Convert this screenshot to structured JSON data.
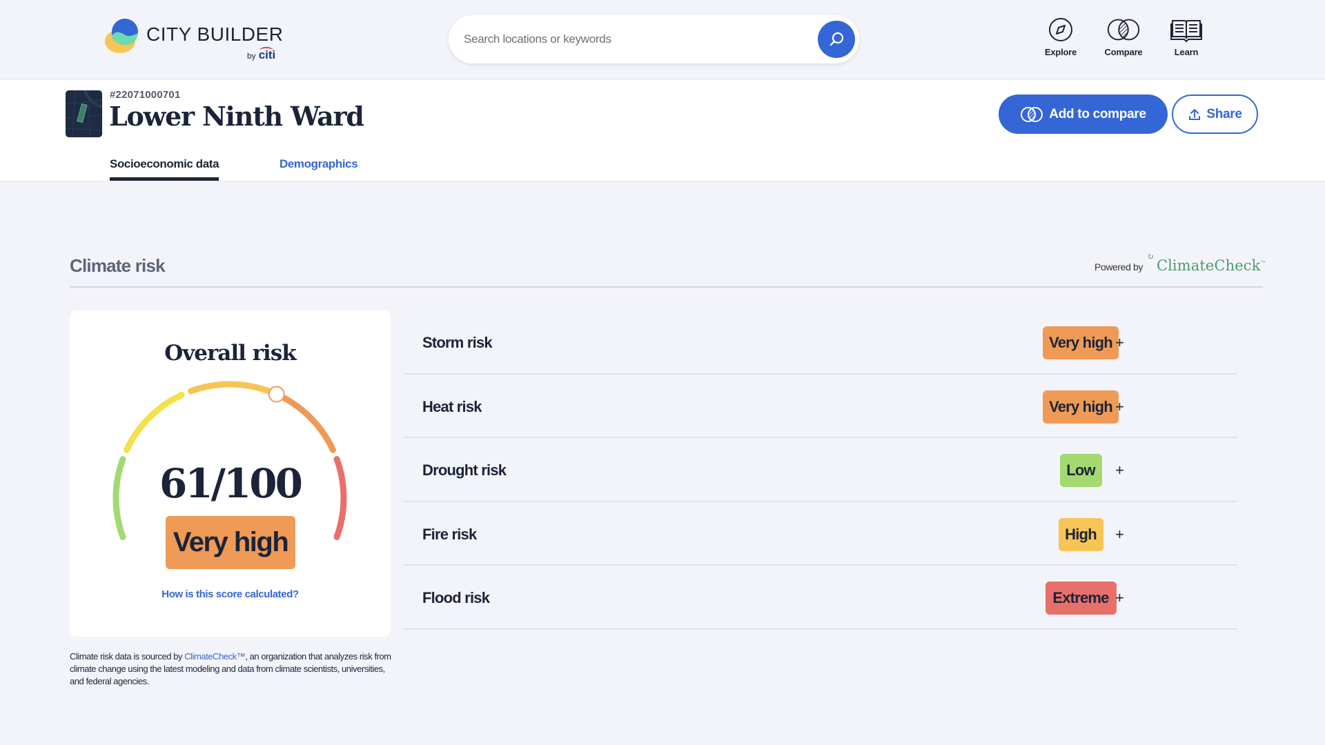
{
  "header": {
    "logo_title": "CITY BUILDER",
    "logo_by": "by",
    "logo_brand": "citi",
    "search_placeholder": "Search locations or keywords",
    "search_value": "",
    "nav": [
      {
        "label": "Explore",
        "icon": "compass-icon"
      },
      {
        "label": "Compare",
        "icon": "compare-circles-icon"
      },
      {
        "label": "Learn",
        "icon": "book-icon"
      }
    ]
  },
  "location": {
    "geo_id": "#22071000701",
    "title": "Lower Ninth Ward",
    "add_to_compare_label": "Add to compare",
    "share_label": "Share",
    "tabs": [
      {
        "label": "Socioeconomic data",
        "active": true
      },
      {
        "label": "Demographics",
        "active": false
      }
    ]
  },
  "climate": {
    "section_title": "Climate risk",
    "powered_by": "Powered by",
    "provider": "ClimateCheck",
    "overall": {
      "title": "Overall risk",
      "score": 61,
      "max": 100,
      "score_text": "61/100",
      "level": "Very high",
      "level_color": "#ef9a57",
      "calc_link": "How is this score calculated?"
    },
    "gauge_segments": [
      {
        "level": "Low",
        "color": "#a3d96f"
      },
      {
        "level": "Medium",
        "color": "#f4e04d"
      },
      {
        "level": "High",
        "color": "#f6c555"
      },
      {
        "level": "Very high",
        "color": "#ef9a57"
      },
      {
        "level": "Extreme",
        "color": "#e8706b"
      }
    ],
    "source_note_prefix": "Climate risk data is sourced by ",
    "source_note_link": "ClimateCheck™",
    "source_note_suffix": ", an organization that analyzes risk from climate change using the latest modeling and data from climate scientists, universities, and federal agencies.",
    "risks": [
      {
        "label": "Storm risk",
        "level": "Very high",
        "color": "#ef9a57"
      },
      {
        "label": "Heat risk",
        "level": "Very high",
        "color": "#ef9a57"
      },
      {
        "label": "Drought risk",
        "level": "Low",
        "color": "#a3d96f"
      },
      {
        "label": "Fire risk",
        "level": "High",
        "color": "#f6c555"
      },
      {
        "label": "Flood risk",
        "level": "Extreme",
        "color": "#e8706b"
      }
    ],
    "expand_symbol": "+"
  },
  "colors": {
    "accent": "#3466d6",
    "text": "#1b2438"
  }
}
